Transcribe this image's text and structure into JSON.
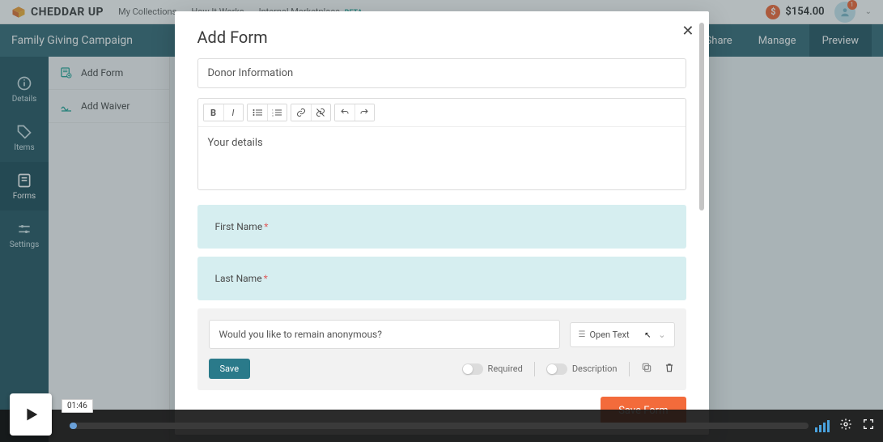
{
  "brand": "CHEDDAR UP",
  "topnav": {
    "collections": "My Collections",
    "how": "How It Works",
    "marketplace": "Internal Marketplace",
    "beta": "BETA"
  },
  "balance": "$154.00",
  "user": {
    "notif": "1"
  },
  "subheader": {
    "title": "Family Giving Campaign",
    "share": "Share",
    "manage": "Manage",
    "preview": "Preview"
  },
  "rail": {
    "details": "Details",
    "items": "Items",
    "forms": "Forms",
    "settings": "Settings"
  },
  "submenu": {
    "addForm": "Add Form",
    "addWaiver": "Add Waiver"
  },
  "modal": {
    "title": "Add Form",
    "formTitle": "Donor Information",
    "rteBody": "Your details",
    "field1": "First Name",
    "field2": "Last Name",
    "question": "Would you like to remain anonymous?",
    "typeLabel": "Open Text",
    "saveBtn": "Save",
    "requiredLabel": "Required",
    "descriptionLabel": "Description",
    "saveForm": "Save Form"
  },
  "video": {
    "time": "01:46"
  }
}
